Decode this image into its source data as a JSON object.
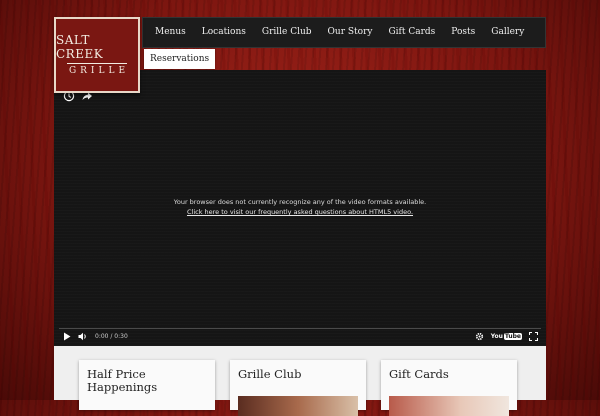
{
  "logo": {
    "line1": "SALT CREEK",
    "line2": "GRILLE"
  },
  "nav": {
    "items": [
      "Menus",
      "Locations",
      "Grille Club",
      "Our Story",
      "Gift Cards",
      "Posts",
      "Gallery"
    ],
    "reservations": "Reservations"
  },
  "video": {
    "message": "Your browser does not currently recognize any of the video formats available.",
    "link": "Click here to visit our frequently asked questions about HTML5 video.",
    "time": "0:00 / 0:30",
    "progress": 0,
    "youtube_label": "You",
    "youtube_tube": "Tube"
  },
  "cards": [
    {
      "title_line1": "Half Price",
      "title_line2": "Happenings"
    },
    {
      "title_line1": "Grille Club",
      "title_line2": ""
    },
    {
      "title_line1": "Gift Cards",
      "title_line2": ""
    }
  ]
}
